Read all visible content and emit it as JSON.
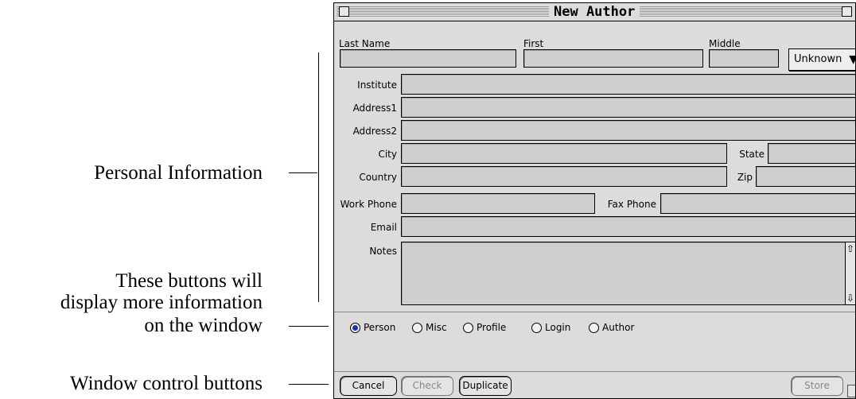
{
  "annotations": {
    "personal": "Personal Information",
    "buttons_line1": "These buttons will",
    "buttons_line2": "display more information",
    "buttons_line3": "on the window",
    "window_controls": "Window control buttons"
  },
  "window": {
    "title": "New Author"
  },
  "form": {
    "last_name_label": "Last Name",
    "first_label": "First",
    "middle_label": "Middle",
    "gender_popup": "Unknown",
    "institute_label": "Institute",
    "address1_label": "Address1",
    "address2_label": "Address2",
    "city_label": "City",
    "state_label": "State",
    "country_label": "Country",
    "zip_label": "Zip",
    "work_phone_label": "Work Phone",
    "fax_phone_label": "Fax Phone",
    "email_label": "Email",
    "notes_label": "Notes"
  },
  "tabs": {
    "selected": "Person",
    "options": [
      "Person",
      "Misc",
      "Profile",
      "Login",
      "Author"
    ]
  },
  "buttons": {
    "cancel": "Cancel",
    "check": "Check",
    "duplicate": "Duplicate",
    "store": "Store"
  }
}
